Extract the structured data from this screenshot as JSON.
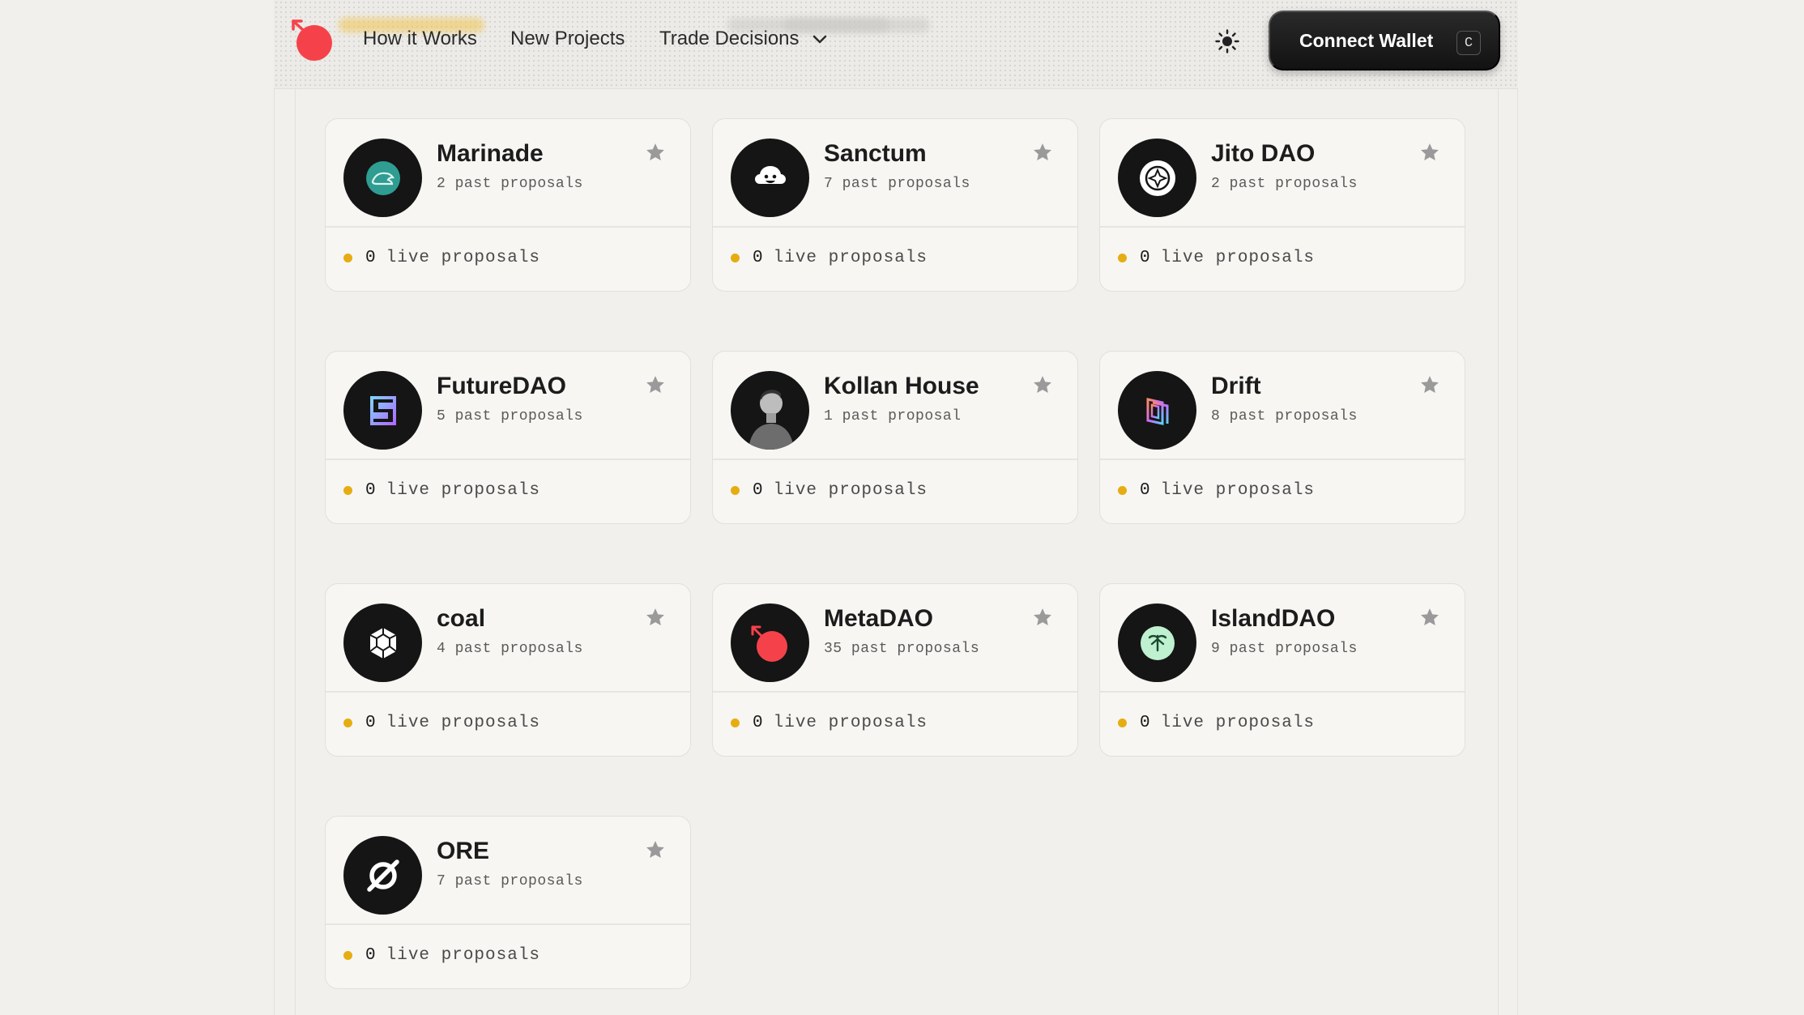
{
  "header": {
    "nav": [
      {
        "label": "How it Works"
      },
      {
        "label": "New Projects"
      },
      {
        "label": "Trade Decisions"
      }
    ],
    "connect_label": "Connect Wallet",
    "connect_shortcut": "C"
  },
  "colors": {
    "accent": "#f5424a",
    "live_dot": "#e6ad12",
    "button_bg": "#1a1a1a"
  },
  "projects": [
    {
      "name": "Marinade",
      "past": "2 past proposals",
      "live_count": "0",
      "live_label": "live proposals",
      "icon": "marinade-icon"
    },
    {
      "name": "Sanctum",
      "past": "7 past proposals",
      "live_count": "0",
      "live_label": "live proposals",
      "icon": "sanctum-icon"
    },
    {
      "name": "Jito DAO",
      "past": "2 past proposals",
      "live_count": "0",
      "live_label": "live proposals",
      "icon": "jito-icon"
    },
    {
      "name": "FutureDAO",
      "past": "5 past proposals",
      "live_count": "0",
      "live_label": "live proposals",
      "icon": "futuredao-icon"
    },
    {
      "name": "Kollan House",
      "past": "1 past proposal",
      "live_count": "0",
      "live_label": "live proposals",
      "icon": "kollan-house-icon"
    },
    {
      "name": "Drift",
      "past": "8 past proposals",
      "live_count": "0",
      "live_label": "live proposals",
      "icon": "drift-icon"
    },
    {
      "name": "coal",
      "past": "4 past proposals",
      "live_count": "0",
      "live_label": "live proposals",
      "icon": "coal-icon"
    },
    {
      "name": "MetaDAO",
      "past": "35 past proposals",
      "live_count": "0",
      "live_label": "live proposals",
      "icon": "metadao-icon"
    },
    {
      "name": "IslandDAO",
      "past": "9 past proposals",
      "live_count": "0",
      "live_label": "live proposals",
      "icon": "islanddao-icon"
    },
    {
      "name": "ORE",
      "past": "7 past proposals",
      "live_count": "0",
      "live_label": "live proposals",
      "icon": "ore-icon"
    }
  ]
}
